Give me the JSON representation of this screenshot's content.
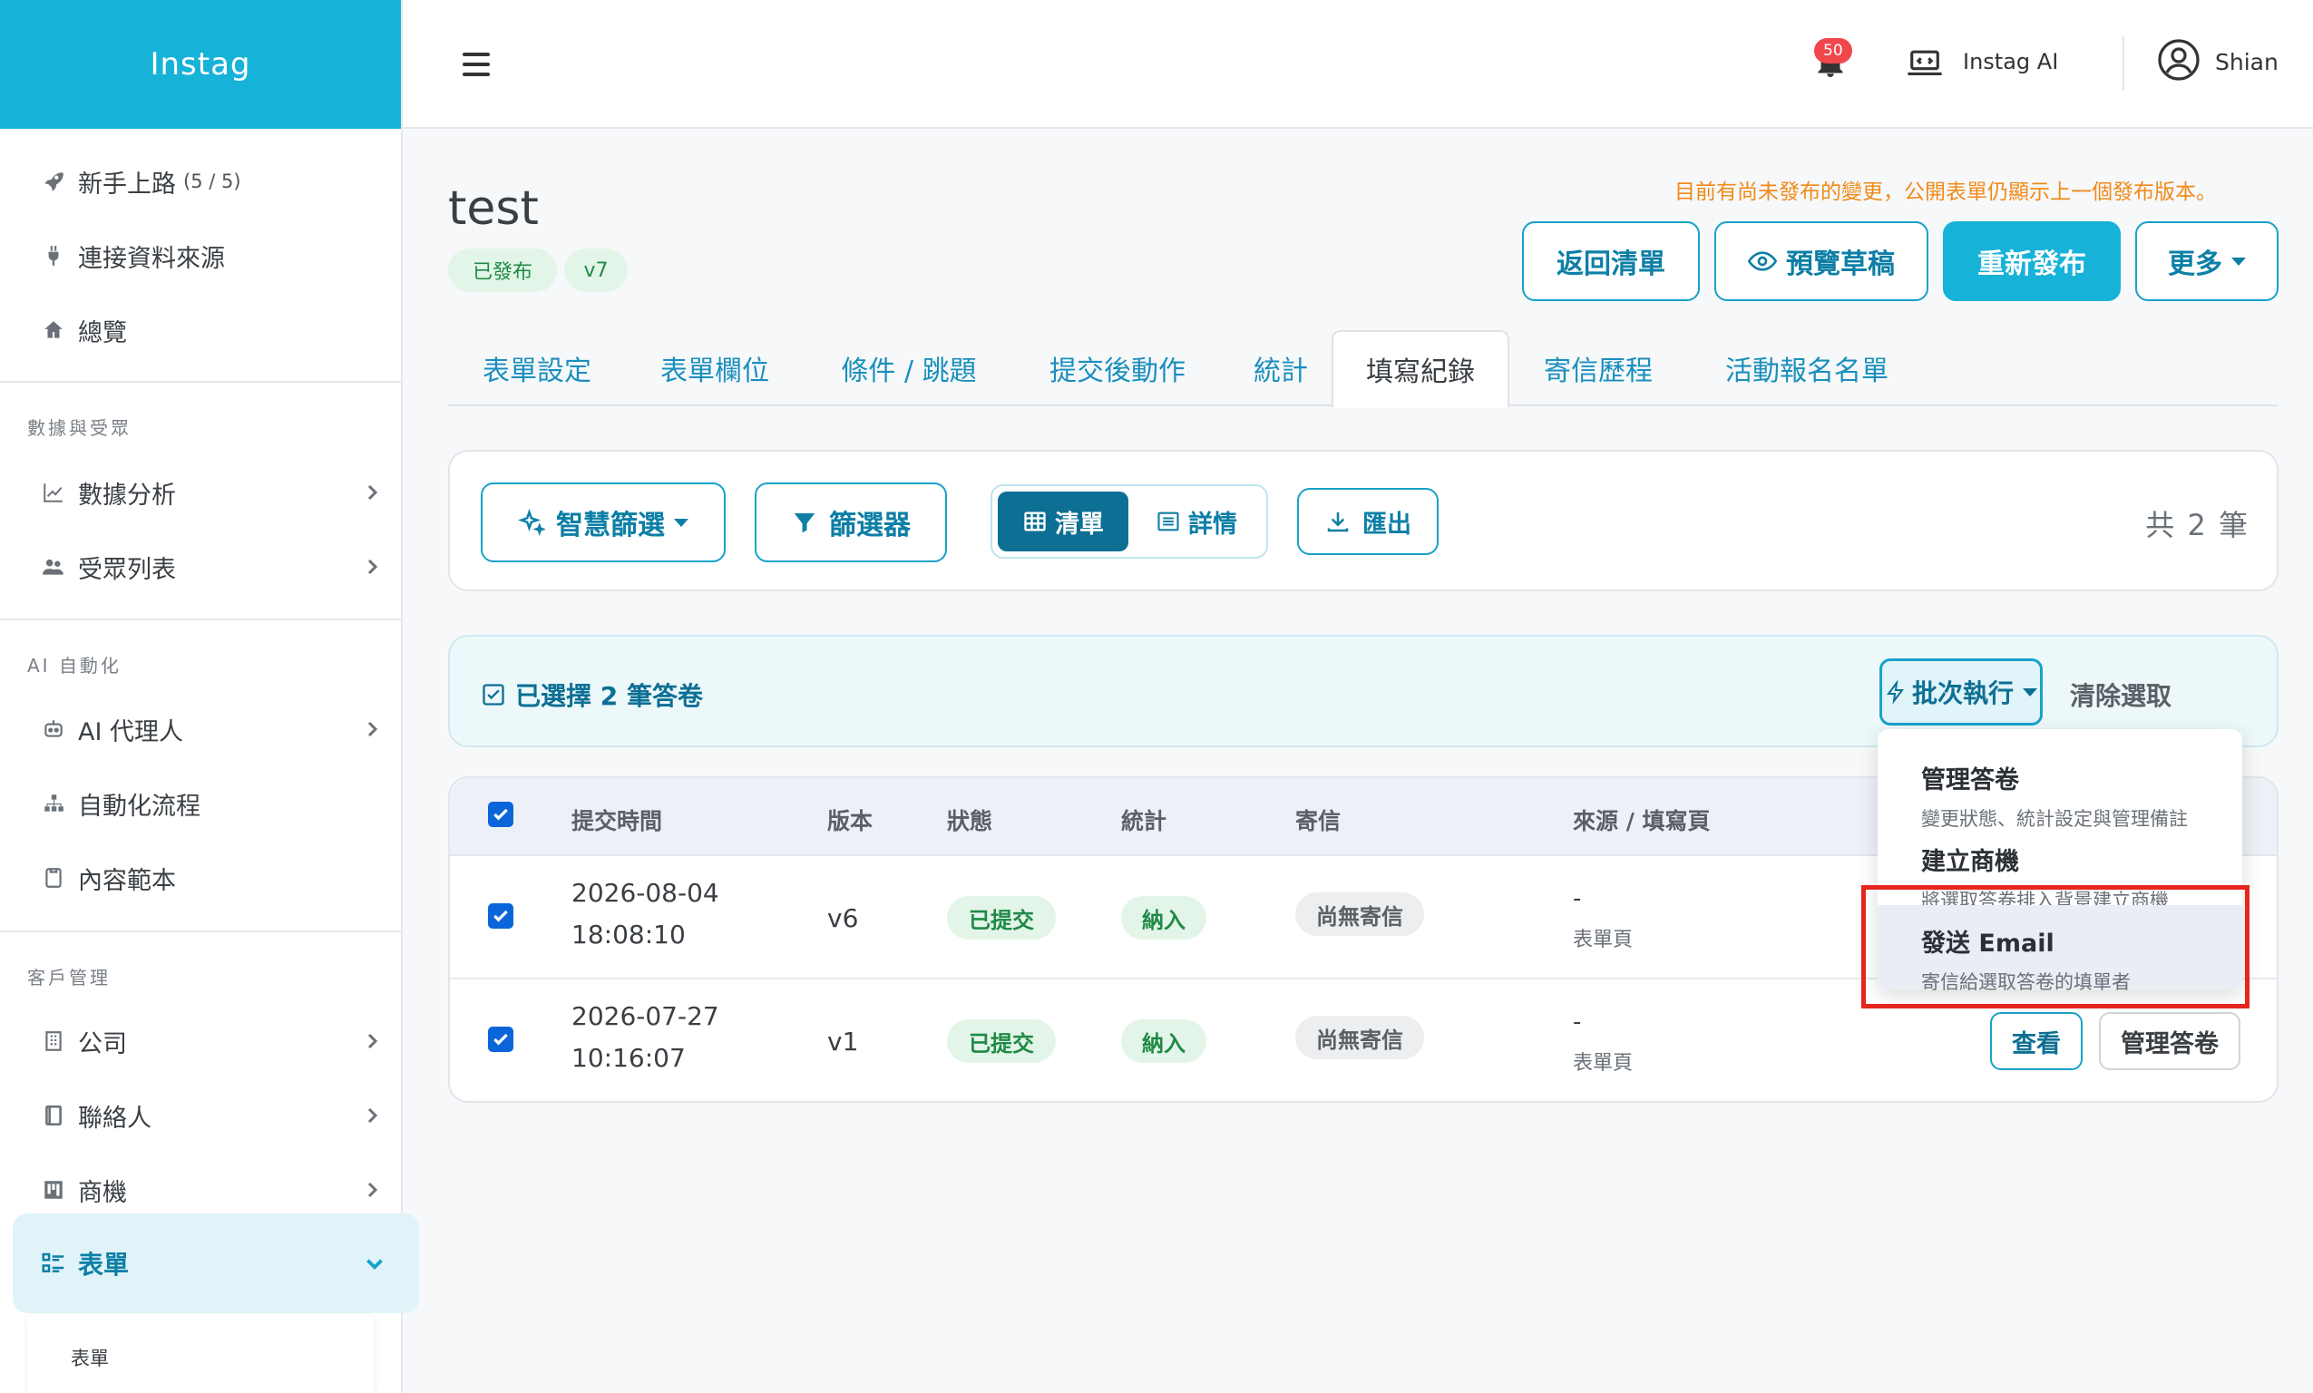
{
  "brand": "Instag",
  "sidebar": {
    "items_top": [
      {
        "label": "新手上路",
        "sub": "(5 / 5)",
        "icon": "rocket-icon"
      },
      {
        "label": "連接資料來源",
        "icon": "plug-icon"
      },
      {
        "label": "總覽",
        "icon": "home-icon"
      }
    ],
    "section_data": "數據與受眾",
    "items_data": [
      {
        "label": "數據分析",
        "icon": "chart-icon"
      },
      {
        "label": "受眾列表",
        "icon": "users-icon"
      }
    ],
    "section_ai": "AI 自動化",
    "items_ai": [
      {
        "label": "AI 代理人",
        "icon": "robot-icon"
      },
      {
        "label": "自動化流程",
        "icon": "flow-icon"
      },
      {
        "label": "內容範本",
        "icon": "template-icon"
      }
    ],
    "section_crm": "客戶管理",
    "items_crm": [
      {
        "label": "公司",
        "icon": "building-icon"
      },
      {
        "label": "聯絡人",
        "icon": "contact-icon"
      },
      {
        "label": "商機",
        "icon": "kanban-icon"
      }
    ],
    "active_item": "表單",
    "submenu_item": "表單"
  },
  "header": {
    "notification_count": "50",
    "ai_label": "Instag AI",
    "user_name": "Shian"
  },
  "page": {
    "title": "test",
    "status_pill": "已發布",
    "version_pill": "v7",
    "notice": "目前有尚未發布的變更，公開表單仍顯示上一個發布版本。",
    "buttons": {
      "back": "返回清單",
      "preview": "預覽草稿",
      "republish": "重新發布",
      "more": "更多"
    }
  },
  "tabs": [
    "表單設定",
    "表單欄位",
    "條件 / 跳題",
    "提交後動作",
    "統計",
    "填寫紀錄",
    "寄信歷程",
    "活動報名名單"
  ],
  "active_tab": "填寫紀錄",
  "filters": {
    "smart_filter": "智慧篩選",
    "filter": "篩選器",
    "view_list": "清單",
    "view_detail": "詳情",
    "export": "匯出",
    "total": "共 2 筆"
  },
  "selection": {
    "text": "已選擇 2 筆答卷",
    "batch": "批次執行",
    "clear": "清除選取"
  },
  "table": {
    "headers": [
      "提交時間",
      "版本",
      "狀態",
      "統計",
      "寄信",
      "來源 / 填寫頁"
    ],
    "rows": [
      {
        "date": "2026-08-04",
        "time": "18:08:10",
        "version": "v6",
        "status": "已提交",
        "stat": "納入",
        "mail": "尚無寄信",
        "source": "-",
        "source_page": "表單頁",
        "checked": true
      },
      {
        "date": "2026-07-27",
        "time": "10:16:07",
        "version": "v1",
        "status": "已提交",
        "stat": "納入",
        "mail": "尚無寄信",
        "source": "-",
        "source_page": "表單頁",
        "checked": true
      }
    ],
    "row_actions": {
      "view": "查看",
      "manage": "管理答卷"
    }
  },
  "dropdown": {
    "items": [
      {
        "title": "管理答卷",
        "desc": "變更狀態、統計設定與管理備註"
      },
      {
        "title": "建立商機",
        "desc": "將選取答卷排入背景建立商機"
      },
      {
        "title": "發送 Email",
        "desc": "寄信給選取答卷的填單者"
      }
    ]
  },
  "colors": {
    "brand": "#17b2d8",
    "accent": "#0d7fa6",
    "highlight": "#e5261d",
    "notice": "#f08a18"
  }
}
